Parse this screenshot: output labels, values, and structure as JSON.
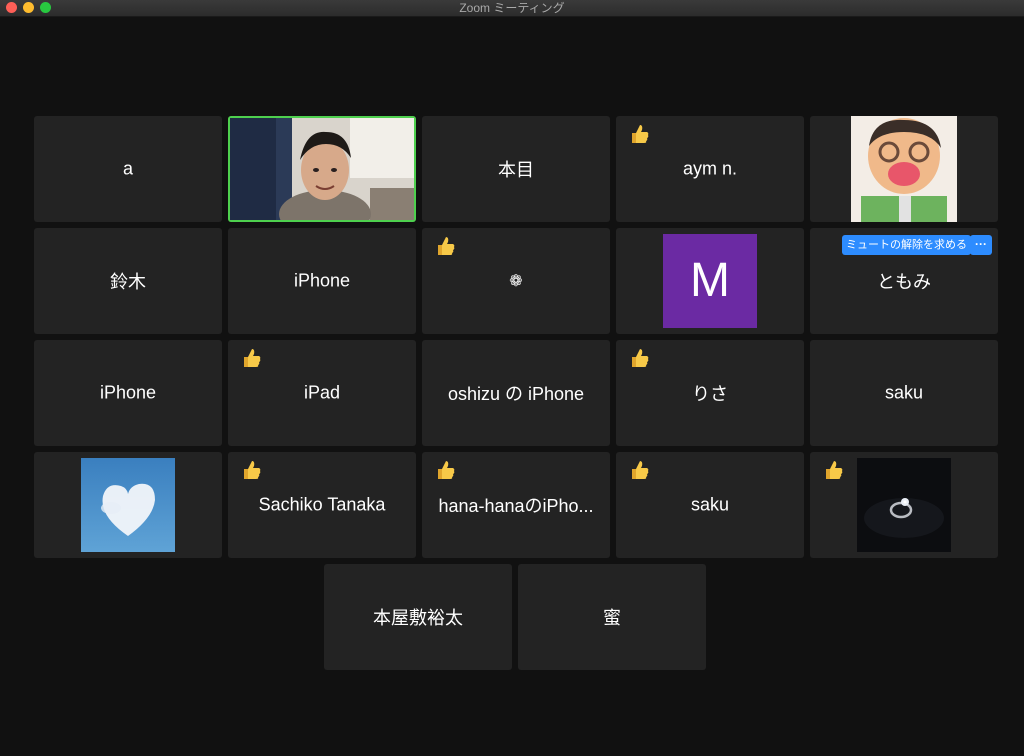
{
  "window": {
    "title": "Zoom ミーティング"
  },
  "tiles": {
    "t1": {
      "name": "a"
    },
    "t3": {
      "name": "本目"
    },
    "t4": {
      "name": "aym n."
    },
    "t6": {
      "name": "鈴木"
    },
    "t7": {
      "name": "iPhone"
    },
    "t8": {
      "name": "❁"
    },
    "t9": {
      "avatar_letter": "M",
      "avatar_color": "#6b2aa3"
    },
    "t10": {
      "name": "ともみ",
      "unmute_label": "ミュートの解除を求める",
      "more_label": "···"
    },
    "t11": {
      "name": "iPhone"
    },
    "t12": {
      "name": "iPad"
    },
    "t13": {
      "name": "oshizu の iPhone"
    },
    "t14": {
      "name": "りさ"
    },
    "t15": {
      "name": "saku"
    },
    "t17": {
      "name": "Sachiko Tanaka"
    },
    "t18": {
      "name": "hana-hanaのiPho..."
    },
    "t19": {
      "name": "saku"
    },
    "t21": {
      "name": "本屋敷裕太"
    },
    "t22": {
      "name": "蜜"
    }
  },
  "colors": {
    "active_speaker": "#4ed04e",
    "accent_button": "#2d8cff",
    "tile_bg": "#232323"
  },
  "reaction_icon": "thumbs-up-icon"
}
